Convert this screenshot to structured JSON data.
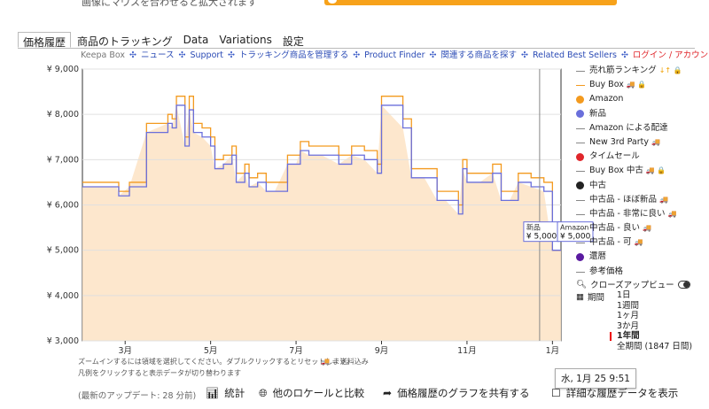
{
  "top": {
    "hint_text": "画像にマウスを合わせると拡大されます"
  },
  "tabs": [
    {
      "label": "価格履歴",
      "active": true
    },
    {
      "label": "商品のトラッキング"
    },
    {
      "label": "Data"
    },
    {
      "label": "Variations"
    },
    {
      "label": "設定"
    }
  ],
  "links": {
    "keepa_box": "Keepa Box",
    "news": "ニュース",
    "support": "Support",
    "manage_tracking": "トラッキング商品を管理する",
    "product_finder": "Product Finder",
    "find_related": "関連する商品を探す",
    "related_best": "Related Best Sellers",
    "login": "ログイン / アカウントの登録"
  },
  "legend": {
    "items": [
      {
        "label": "売れ筋ランキング",
        "type": "line",
        "color": "#888888",
        "extra": "↓↑ 🔒"
      },
      {
        "label": "Buy Box",
        "type": "line",
        "color": "#f39a1f",
        "extra": "🚚 🔒"
      },
      {
        "label": "Amazon",
        "type": "dot",
        "color": "#f39a1f"
      },
      {
        "label": "新品",
        "type": "dot",
        "color": "#6a6fdb"
      },
      {
        "label": "Amazon による配達",
        "type": "line",
        "color": "#888888"
      },
      {
        "label": "New 3rd Party",
        "type": "line",
        "color": "#888888",
        "extra": "🚚"
      },
      {
        "label": "タイムセール",
        "type": "dot",
        "color": "#e0262b"
      },
      {
        "label": "Buy Box 中古",
        "type": "line",
        "color": "#888888",
        "extra": "🚚 🔒"
      },
      {
        "label": "中古",
        "type": "dot",
        "color": "#222222"
      },
      {
        "label": "中古品 - ほぼ新品",
        "type": "line",
        "color": "#888888",
        "extra": "🚚"
      },
      {
        "label": "中古品 - 非常に良い",
        "type": "line",
        "color": "#888888",
        "extra": "🚚"
      },
      {
        "label": "中古品 - 良い",
        "type": "line",
        "color": "#888888",
        "extra": "🚚"
      },
      {
        "label": "中古品 - 可",
        "type": "line",
        "color": "#888888",
        "extra": "🚚"
      },
      {
        "label": "還暦",
        "type": "dot",
        "color": "#5a1aa0"
      },
      {
        "label": "参考価格",
        "type": "line",
        "color": "#888888"
      }
    ]
  },
  "range": {
    "closeup_label": "クローズアップビュー",
    "period_label": "期間",
    "options": [
      "1日",
      "1週間",
      "1ヶ月",
      "3か月",
      "1年間",
      "全期間 (1847 日間)"
    ],
    "selected": "1年間"
  },
  "hints": {
    "zoom": "ズームインするには領域を選択してください。ダブルクリックするとリセットします。",
    "legend": "凡例をクリックすると表示データが切り替わります",
    "free_shipping": "🚚 = 送料込み"
  },
  "tooltip": {
    "date": "水, 1月 25 9:51"
  },
  "bottom": {
    "last_update": "(最新のアップデート: 28 分前)",
    "stats": "統計",
    "compare_locales": "他のロケールと比較",
    "share_graph": "価格履歴のグラフを共有する",
    "show_details": "詳細な履歴データを表示"
  },
  "chart_data": {
    "type": "line",
    "ylim": [
      3000,
      9000
    ],
    "yticks": [
      "¥ 3,000",
      "¥ 4,000",
      "¥ 5,000",
      "¥ 6,000",
      "¥ 7,000",
      "¥ 8,000",
      "¥ 9,000"
    ],
    "xticks": [
      "3月",
      "5月",
      "7月",
      "9月",
      "11月",
      "1月"
    ],
    "series": [
      {
        "name": "Amazon",
        "color": "#f39a1f",
        "x": [
          0,
          0.8,
          0.85,
          1.1,
          1.5,
          2.0,
          2.1,
          2.2,
          2.4,
          2.5,
          2.6,
          2.8,
          3.0,
          3.1,
          3.3,
          3.5,
          3.6,
          3.8,
          3.9,
          4.1,
          4.3,
          4.5,
          4.8,
          5.0,
          5.1,
          5.3,
          5.6,
          6.0,
          6.3,
          6.6,
          6.9,
          7.0,
          7.5,
          7.7,
          8.0,
          8.3,
          8.5,
          8.8,
          8.9,
          9.0,
          9.3,
          9.6,
          9.8,
          10.0,
          10.2,
          10.5,
          10.8,
          11.0,
          11.2
        ],
        "y": [
          6500,
          6500,
          6300,
          6500,
          7800,
          8000,
          7900,
          8400,
          7500,
          8400,
          7800,
          7700,
          7500,
          7000,
          7100,
          7300,
          6700,
          6900,
          6600,
          6700,
          6500,
          6500,
          7100,
          7100,
          7400,
          7300,
          7300,
          7100,
          7300,
          7200,
          6900,
          8400,
          7900,
          6800,
          6800,
          6300,
          6300,
          6000,
          7000,
          6700,
          6700,
          6900,
          6300,
          6300,
          6700,
          6600,
          6500,
          5000,
          5000
        ]
      },
      {
        "name": "新品",
        "color": "#6a6fdb",
        "x": [
          0,
          0.8,
          0.85,
          1.1,
          1.5,
          2.0,
          2.1,
          2.2,
          2.4,
          2.5,
          2.6,
          2.8,
          3.0,
          3.1,
          3.3,
          3.5,
          3.6,
          3.8,
          3.9,
          4.1,
          4.3,
          4.5,
          4.8,
          5.0,
          5.1,
          5.3,
          5.6,
          6.0,
          6.3,
          6.6,
          6.9,
          7.0,
          7.5,
          7.7,
          8.0,
          8.3,
          8.5,
          8.8,
          8.9,
          9.0,
          9.3,
          9.6,
          9.8,
          10.0,
          10.2,
          10.5,
          10.8,
          11.0,
          11.2
        ],
        "y": [
          6400,
          6400,
          6200,
          6400,
          7600,
          7800,
          7700,
          8200,
          7300,
          8100,
          7600,
          7500,
          7300,
          6800,
          6900,
          7100,
          6500,
          6700,
          6400,
          6500,
          6300,
          6300,
          6900,
          6900,
          7200,
          7100,
          7100,
          6900,
          7100,
          7000,
          6700,
          8200,
          7700,
          6600,
          6600,
          6100,
          6100,
          5800,
          6800,
          6500,
          6500,
          6700,
          6100,
          6100,
          6500,
          6400,
          6300,
          5000,
          5000
        ]
      }
    ],
    "label_new": "新品",
    "label_new_value": "¥ 5,000",
    "label_amazon": "Amazon",
    "label_amazon_value": "¥ 5,000"
  }
}
